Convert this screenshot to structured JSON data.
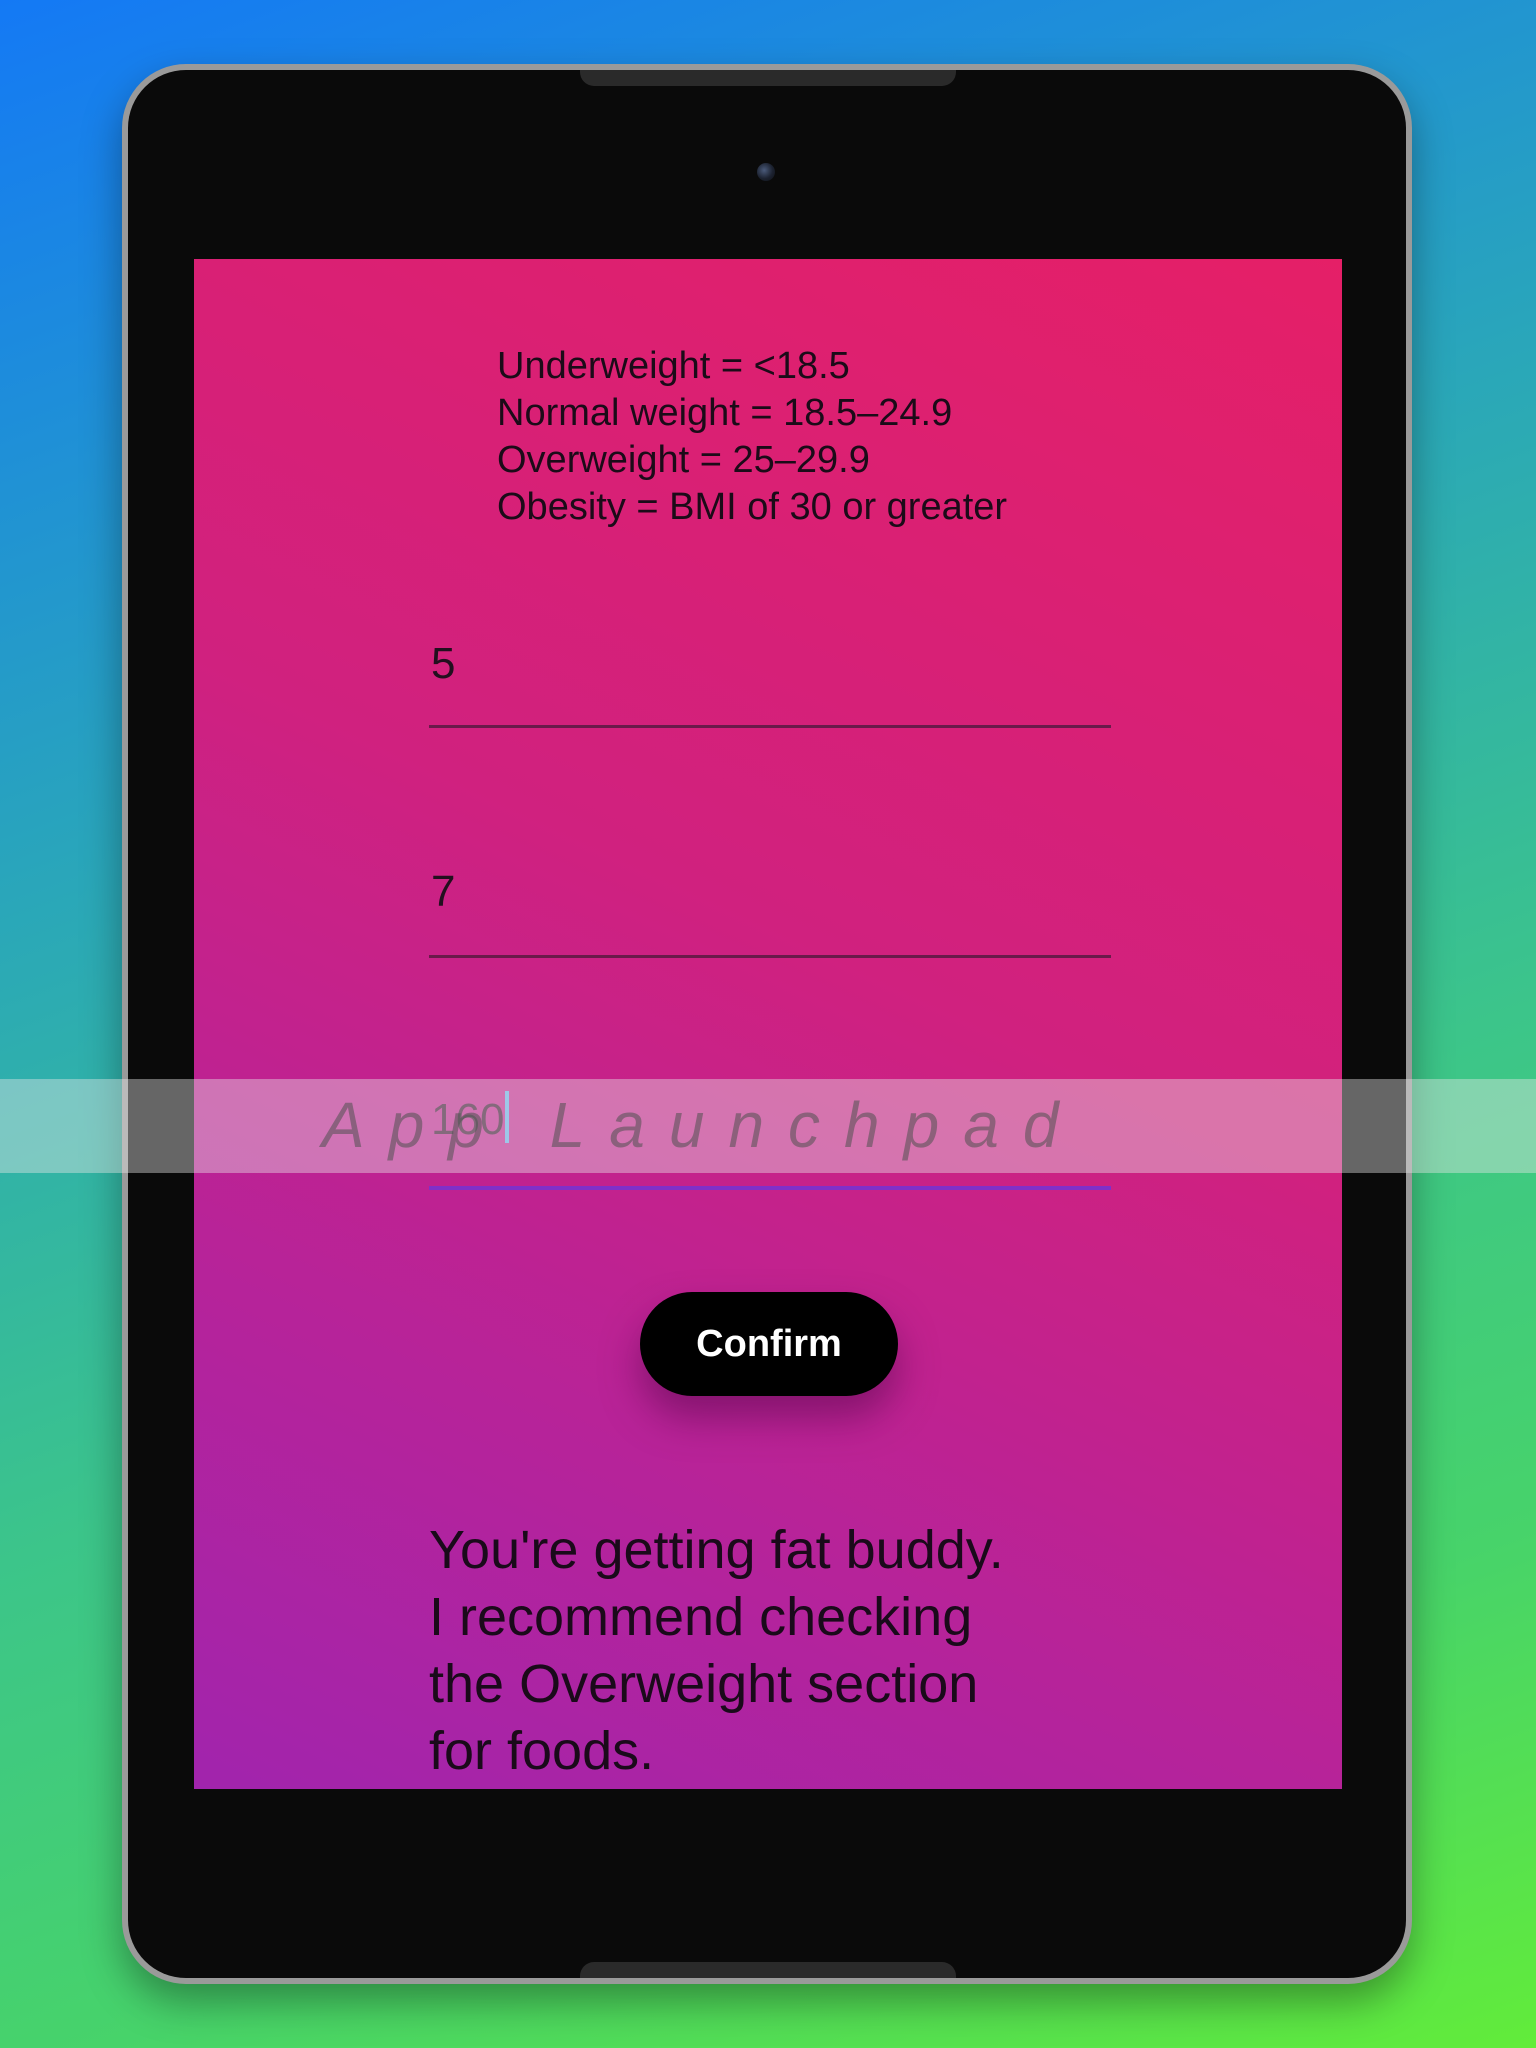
{
  "bmi_categories": [
    "Underweight = <18.5",
    "Normal weight = 18.5–24.9",
    "Overweight = 25–29.9",
    "Obesity = BMI of 30 or greater"
  ],
  "inputs": {
    "feet": "5",
    "inches": "7",
    "weight": "160"
  },
  "confirm_label": "Confirm",
  "result_text": "You're getting fat buddy.\nI recommend checking\nthe Overweight section\nfor foods.",
  "watermark": "App Launchpad",
  "colors": {
    "screen_gradient_top": "#e51f67",
    "screen_gradient_bottom": "#a124ad",
    "button_bg": "#000000",
    "button_text": "#ffffff",
    "active_underline": "#8030c8"
  }
}
